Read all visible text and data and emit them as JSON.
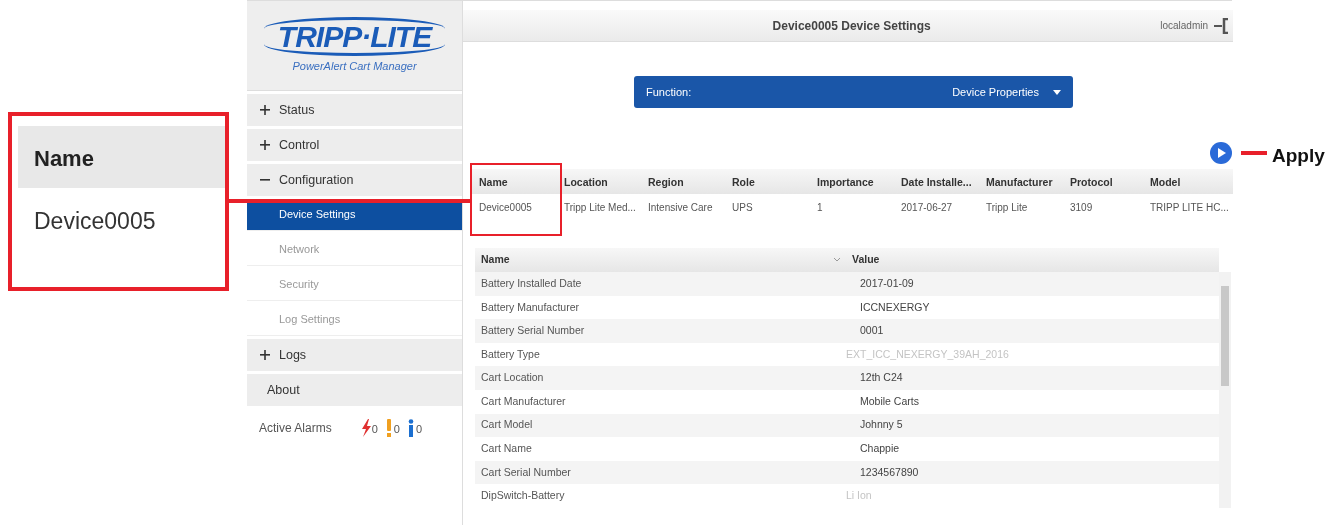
{
  "sidebar": {
    "logo": "TRIPP·LITE",
    "subtitle": "PowerAlert Cart Manager",
    "items": [
      {
        "label": "Status",
        "kind": "group",
        "expanded": false
      },
      {
        "label": "Control",
        "kind": "group",
        "expanded": false
      },
      {
        "label": "Configuration",
        "kind": "group",
        "expanded": true,
        "children": [
          {
            "label": "Device Settings",
            "selected": true
          },
          {
            "label": "Network",
            "selected": false
          },
          {
            "label": "Security",
            "selected": false
          },
          {
            "label": "Log Settings",
            "selected": false
          }
        ]
      },
      {
        "label": "Logs",
        "kind": "group",
        "expanded": false
      },
      {
        "label": "About",
        "kind": "link"
      }
    ],
    "alarms": {
      "label": "Active Alarms",
      "counts": [
        {
          "kind": "critical",
          "count": "0"
        },
        {
          "kind": "warning",
          "count": "0"
        },
        {
          "kind": "info",
          "count": "0"
        }
      ]
    }
  },
  "header": {
    "title": "Device0005 Device Settings",
    "user": "localadmin"
  },
  "function_select": {
    "label": "Function:",
    "value": "Device Properties"
  },
  "device_table": {
    "columns": [
      "Name",
      "Location",
      "Region",
      "Role",
      "Importance",
      "Date Installe...",
      "Manufacturer",
      "Protocol",
      "Model"
    ],
    "rows": [
      [
        "Device0005",
        "Tripp Lite Med...",
        "Intensive Care",
        "UPS",
        "1",
        "2017-06-27",
        "Tripp Lite",
        "3109",
        "TRIPP LITE HC..."
      ]
    ]
  },
  "properties_table": {
    "columns": [
      "Name",
      "Value"
    ],
    "rows": [
      {
        "name": "Battery Installed Date",
        "value": "2017-01-09",
        "disabled": false
      },
      {
        "name": "Battery Manufacturer",
        "value": "ICCNEXERGY",
        "disabled": false
      },
      {
        "name": "Battery Serial Number",
        "value": "0001",
        "disabled": false
      },
      {
        "name": "Battery Type",
        "value": "EXT_ICC_NEXERGY_39AH_2016",
        "disabled": true
      },
      {
        "name": "Cart Location",
        "value": "12th C24",
        "disabled": false
      },
      {
        "name": "Cart Manufacturer",
        "value": "Mobile Carts",
        "disabled": false
      },
      {
        "name": "Cart Model",
        "value": "Johnny 5",
        "disabled": false
      },
      {
        "name": "Cart Name",
        "value": "Chappie",
        "disabled": false
      },
      {
        "name": "Cart Serial Number",
        "value": "1234567890",
        "disabled": false
      },
      {
        "name": "DipSwitch-Battery",
        "value": "Li Ion",
        "disabled": true
      }
    ]
  },
  "callouts": {
    "inset": {
      "column": "Name",
      "value": "Device0005"
    },
    "apply": "Apply"
  }
}
